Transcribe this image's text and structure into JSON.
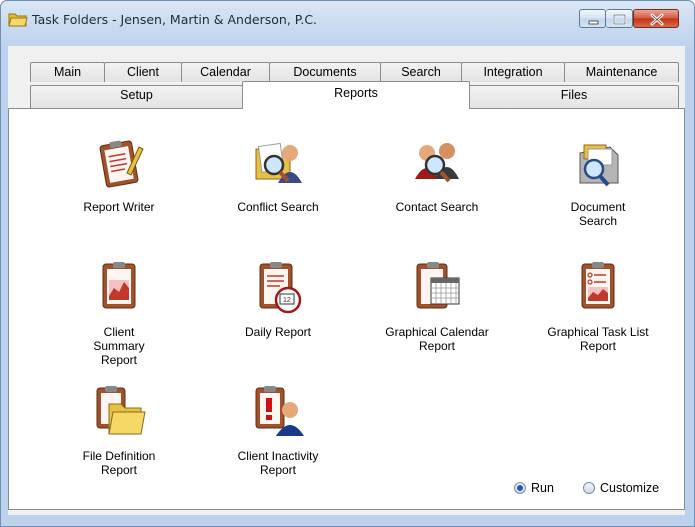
{
  "window": {
    "title": "Task Folders - Jensen, Martin & Anderson, P.C."
  },
  "tabs_top": [
    "Main",
    "Client",
    "Calendar",
    "Documents",
    "Search",
    "Integration",
    "Maintenance"
  ],
  "tabs_bottom": [
    "Setup",
    "Reports",
    "Files"
  ],
  "active_tab": "Reports",
  "reports": [
    {
      "label": "Report Writer",
      "icon": "report-writer-icon"
    },
    {
      "label": "Conflict Search",
      "icon": "conflict-search-icon"
    },
    {
      "label": "Contact Search",
      "icon": "contact-search-icon"
    },
    {
      "label": "Document Search",
      "icon": "document-search-icon"
    },
    {
      "label": "Client Summary Report",
      "icon": "client-summary-report-icon"
    },
    {
      "label": "Daily Report",
      "icon": "daily-report-icon"
    },
    {
      "label": "Graphical Calendar Report",
      "icon": "graphical-calendar-report-icon"
    },
    {
      "label": "Graphical Task List Report",
      "icon": "graphical-task-list-report-icon"
    },
    {
      "label": "File Definition Report",
      "icon": "file-definition-report-icon"
    },
    {
      "label": "Client Inactivity Report",
      "icon": "client-inactivity-report-icon"
    }
  ],
  "mode": {
    "run_label": "Run",
    "customize_label": "Customize",
    "selected": "Run"
  },
  "colors": {
    "clipboard": "#a0522d",
    "paper": "#fdf5f2",
    "accent_red": "#c0392b",
    "folder": "#e8c045",
    "title_bar": "#c6d9ef"
  }
}
